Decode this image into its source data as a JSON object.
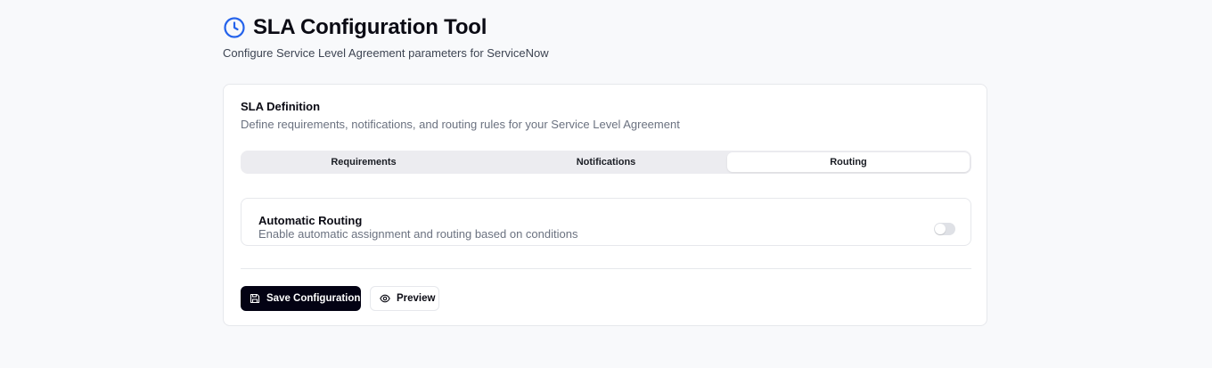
{
  "header": {
    "icon": "clock-icon",
    "title": "SLA Configuration Tool",
    "subtitle": "Configure Service Level Agreement parameters for ServiceNow",
    "accent_color": "#2563eb"
  },
  "card": {
    "title": "SLA Definition",
    "description": "Define requirements, notifications, and routing rules for your Service Level Agreement",
    "tabs": [
      {
        "label": "Requirements",
        "active": false
      },
      {
        "label": "Notifications",
        "active": false
      },
      {
        "label": "Routing",
        "active": true
      }
    ],
    "routing": {
      "title": "Automatic Routing",
      "description": "Enable automatic assignment and routing based on conditions",
      "enabled": false
    }
  },
  "actions": {
    "save_label": "Save Configuration",
    "save_icon": "save-icon",
    "preview_label": "Preview",
    "preview_icon": "eye-icon"
  }
}
